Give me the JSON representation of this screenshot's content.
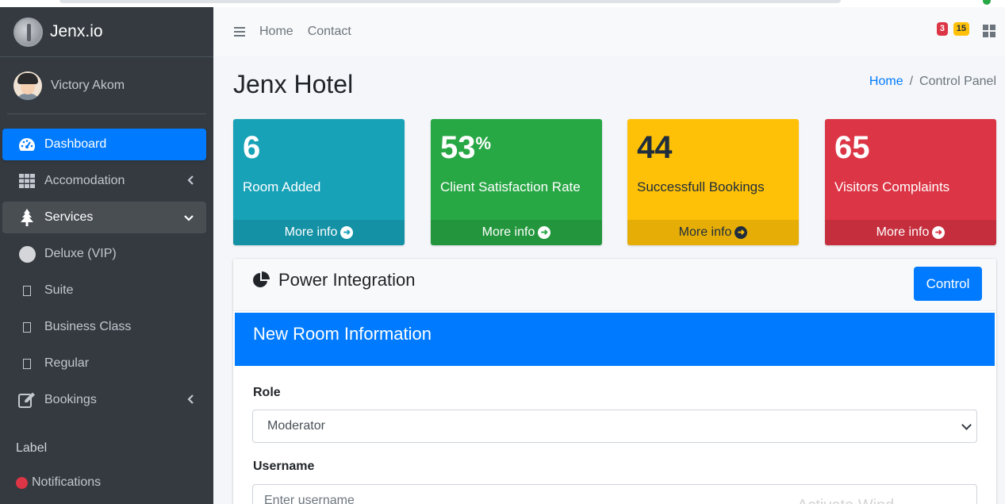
{
  "brand": {
    "name": "Jenx.io"
  },
  "user": {
    "name": "Victory Akom"
  },
  "sidebar": {
    "items": [
      {
        "label": "Dashboard"
      },
      {
        "label": "Accomodation"
      },
      {
        "label": "Services"
      },
      {
        "label": "Deluxe (VIP)"
      },
      {
        "label": "Suite"
      },
      {
        "label": "Business Class"
      },
      {
        "label": "Regular"
      },
      {
        "label": "Bookings"
      }
    ],
    "header_label": "Label",
    "notifications": "Notifications"
  },
  "topnav": {
    "links": [
      "Home",
      "Contact"
    ],
    "badge_messages": "3",
    "badge_notifications": "15"
  },
  "page": {
    "title": "Jenx Hotel",
    "breadcrumb_home": "Home",
    "breadcrumb_current": "Control Panel"
  },
  "stats": [
    {
      "value": "6",
      "suffix": "",
      "label": "Room Added",
      "more": "More info",
      "color": "#17a2b8"
    },
    {
      "value": "53",
      "suffix": "%",
      "label": "Client Satisfaction Rate",
      "more": "More info",
      "color": "#28a745"
    },
    {
      "value": "44",
      "suffix": "",
      "label": "Successfull Bookings",
      "more": "More info",
      "color": "#ffc107"
    },
    {
      "value": "65",
      "suffix": "",
      "label": "Visitors Complaints",
      "more": "More info",
      "color": "#dc3545"
    }
  ],
  "card": {
    "title": "Power Integration",
    "control_button": "Control",
    "form_title": "New Room Information",
    "role_label": "Role",
    "role_value": "Moderator",
    "username_label": "Username",
    "username_placeholder": "Enter username"
  },
  "watermark": "Activate Wind",
  "icons": {
    "dashboard": "tachometer-icon",
    "accomodation": "grid-icon",
    "services": "tree-icon",
    "bookings": "edit-icon",
    "power": "pie-chart-icon"
  }
}
